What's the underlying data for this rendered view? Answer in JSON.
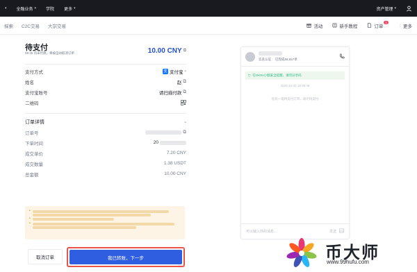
{
  "topbar": {
    "items": [
      "全融业务",
      "学院",
      "更多"
    ],
    "right_item": "资产管理"
  },
  "subnav": {
    "left": [
      "探索",
      "C2C交易",
      "大宗交易"
    ],
    "right": [
      {
        "label": "活动",
        "icon": "gift-icon"
      },
      {
        "label": "新手教程",
        "icon": "book-icon"
      },
      {
        "label": "订单",
        "icon": "order-icon",
        "badge": "1"
      },
      {
        "label": "更多",
        "icon": "more-icon"
      }
    ]
  },
  "order": {
    "title": "待支付",
    "timer_text": "09:35 内未付款，将被自动取消订单",
    "amount": "10.00 CNY",
    "payment_method_label": "支付方式",
    "payment_method_value": "支付宝",
    "name_label": "姓名",
    "name_value": "赵",
    "account_label": "支付宝账号",
    "account_value": "请扫描付款",
    "qr_label": "二维码",
    "details_title": "订单详情",
    "order_no_label": "订单号",
    "order_time_label": "下单时间",
    "order_time_value": "20",
    "unit_price_label": "成交单价",
    "unit_price_value": "7.20 CNY",
    "quantity_label": "成交数量",
    "quantity_value": "1.38 USDT",
    "total_label": "总金额",
    "total_value": "10.00 CNY"
  },
  "buttons": {
    "cancel": "取消订单",
    "confirm": "我已转账，下一步"
  },
  "chat": {
    "verified_text": "实名认证",
    "trades_text": "已完成88,657单",
    "system_notice": "在OKEx小额安全提醒，请勿分享码",
    "timestamp": "2020-12-03 18:39:49",
    "system_message": "您有一笔待支付订单，请尽快支付",
    "input_placeholder": "可以输入你的消息...",
    "send_label": "发送"
  },
  "watermark": {
    "brand": "币大师",
    "url": "www.99hufu.com"
  },
  "colors": {
    "primary": "#2f5fe0",
    "amount_blue": "#1f4fd0",
    "highlight_red": "#e8534a",
    "notice_bg": "#fdf4e6"
  }
}
